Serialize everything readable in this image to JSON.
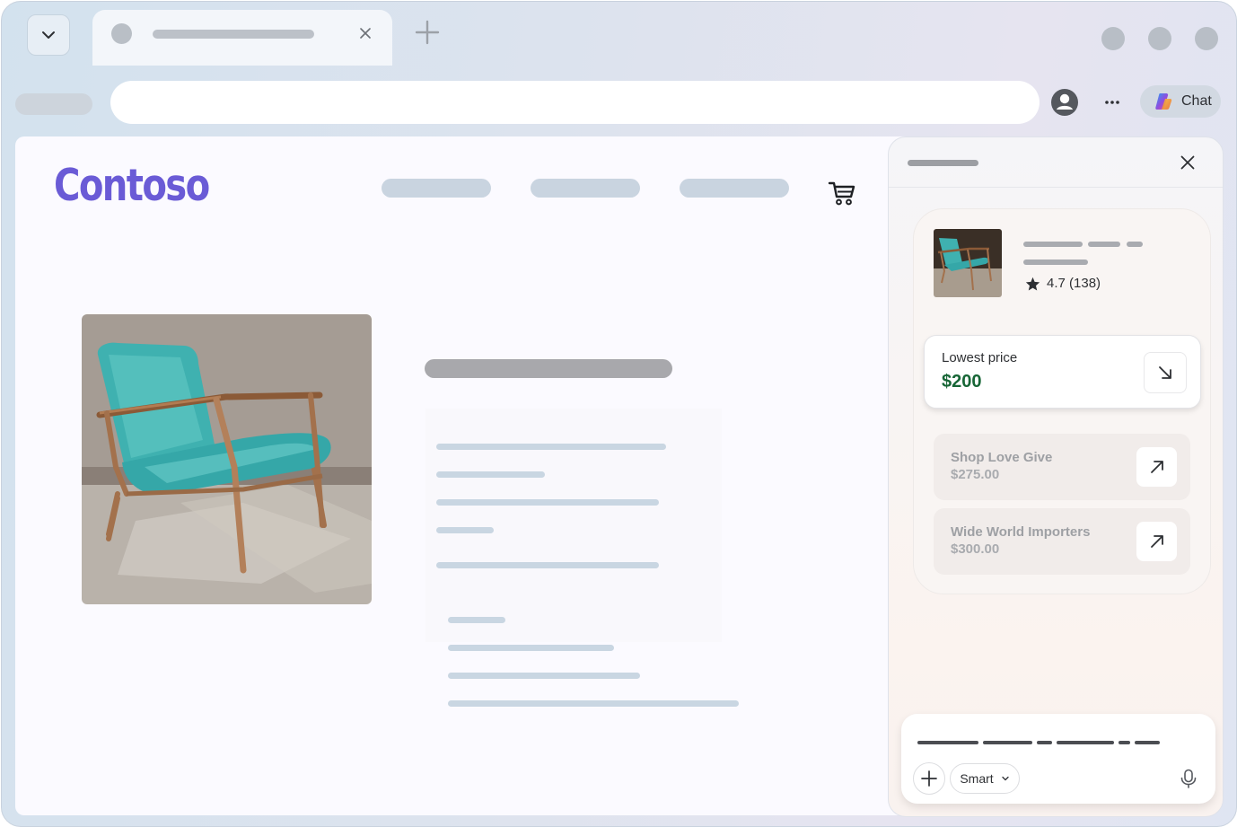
{
  "browser": {
    "chat_label": "Chat"
  },
  "site": {
    "logo": "Contoso"
  },
  "copilot": {
    "product": {
      "rating": "4.7 (138)"
    },
    "lowest_price": {
      "label": "Lowest price",
      "value": "$200"
    },
    "offers": [
      {
        "store": "Shop Love Give",
        "price": "$275.00"
      },
      {
        "store": "Wide World Importers",
        "price": "$300.00"
      }
    ],
    "composer": {
      "mode": "Smart"
    }
  },
  "colors": {
    "logo": "#6a5bd6",
    "price_green": "#176636",
    "chair_teal": "#3fb1b0"
  }
}
